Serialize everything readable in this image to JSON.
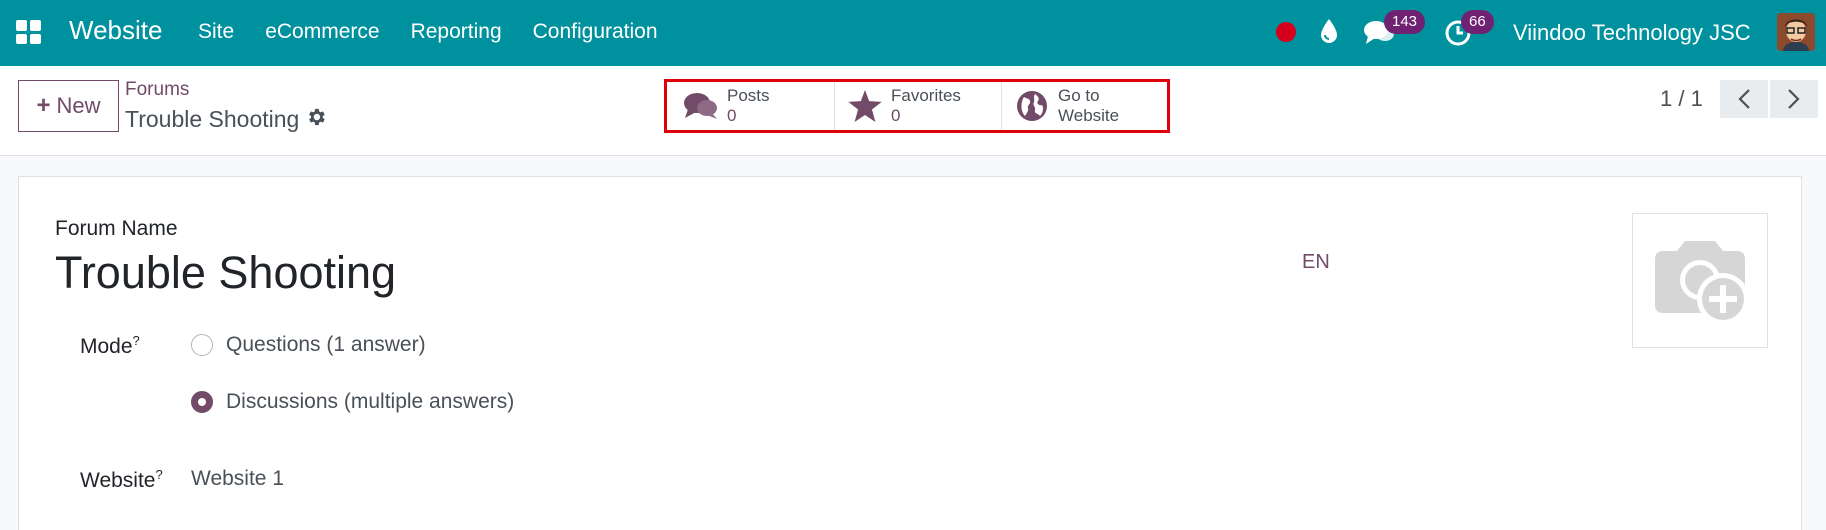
{
  "navbar": {
    "brand": "Website",
    "menu": [
      "Site",
      "eCommerce",
      "Reporting",
      "Configuration"
    ],
    "messages_count": "143",
    "activities_count": "66",
    "company": "Viindoo Technology JSC"
  },
  "control": {
    "new_label": "New",
    "breadcrumb": "Forums",
    "record_title": "Trouble Shooting",
    "smart_buttons": [
      {
        "label": "Posts",
        "value": "0",
        "icon": "comments-icon"
      },
      {
        "label": "Favorites",
        "value": "0",
        "icon": "star-icon"
      },
      {
        "label": "Go to",
        "label2": "Website",
        "icon": "globe-icon"
      }
    ],
    "pager": "1 / 1"
  },
  "form": {
    "name_label": "Forum Name",
    "name_value": "Trouble Shooting",
    "lang": "EN",
    "mode_label": "Mode",
    "help_mark": "?",
    "mode_options": [
      "Questions (1 answer)",
      "Discussions (multiple answers)"
    ],
    "mode_selected": "Discussions (multiple answers)",
    "website_label": "Website",
    "website_value": "Website 1"
  },
  "colors": {
    "navbar": "#00919f",
    "accent": "#714b67",
    "highlight_box": "#e0000a"
  }
}
